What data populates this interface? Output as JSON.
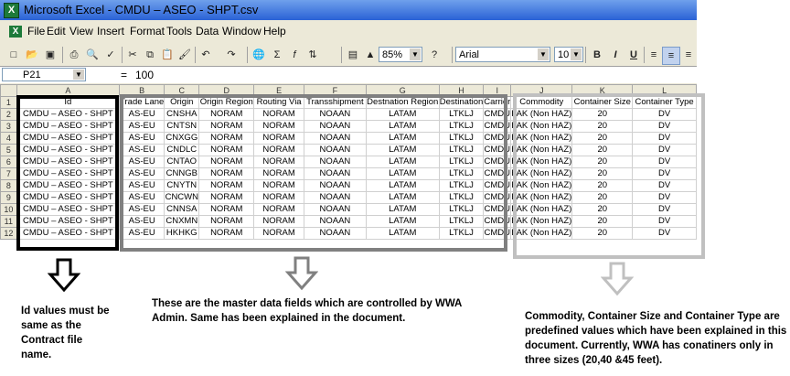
{
  "window": {
    "title": "Microsoft Excel - CMDU – ASEO - SHPT.csv",
    "app_icon": "X"
  },
  "menu": {
    "items": [
      "File",
      "Edit",
      "View",
      "Insert",
      "Format",
      "Tools",
      "Data",
      "Window",
      "Help"
    ]
  },
  "toolbar": {
    "zoom": "85%",
    "font": "Arial",
    "font_size": "10",
    "bold": "B",
    "italic": "I",
    "underline": "U",
    "icons": [
      "new-icon",
      "open-icon",
      "save-icon",
      "print-icon",
      "print-preview-icon",
      "spelling-icon",
      "cut-icon",
      "copy-icon",
      "paste-icon",
      "format-painter-icon",
      "undo-icon",
      "redo-icon",
      "hyperlink-icon",
      "autosum-icon",
      "function-icon",
      "sort-ascending-icon",
      "chart-wizard-icon",
      "drawing-icon",
      "help-icon",
      "align-left-icon",
      "align-center-icon",
      "align-right-icon"
    ]
  },
  "formula_bar": {
    "cell_ref": "P21",
    "equals": "=",
    "value": "100"
  },
  "sheet": {
    "column_letters": [
      "A",
      "B",
      "C",
      "D",
      "E",
      "F",
      "G",
      "H",
      "I",
      "J",
      "K",
      "L"
    ],
    "headers": [
      "Id",
      "Trade Lane",
      "Origin",
      "Origin Region",
      "Routing Via",
      "Transshipment",
      "Destnation Region",
      "Destination",
      "Carrier",
      "Commodity",
      "Container Size",
      "Container Type"
    ],
    "rows": [
      [
        "CMDU – ASEO - SHPT",
        "AS-EU",
        "CNSHA",
        "NORAM",
        "NORAM",
        "NOAAN",
        "LATAM",
        "LTKLJ",
        "CMDU",
        "FAK (Non HAZ)",
        "20",
        "DV"
      ],
      [
        "CMDU – ASEO - SHPT",
        "AS-EU",
        "CNTSN",
        "NORAM",
        "NORAM",
        "NOAAN",
        "LATAM",
        "LTKLJ",
        "CMDU",
        "FAK (Non HAZ)",
        "20",
        "DV"
      ],
      [
        "CMDU – ASEO - SHPT",
        "AS-EU",
        "CNXGG",
        "NORAM",
        "NORAM",
        "NOAAN",
        "LATAM",
        "LTKLJ",
        "CMDU",
        "FAK (Non HAZ)",
        "20",
        "DV"
      ],
      [
        "CMDU – ASEO - SHPT",
        "AS-EU",
        "CNDLC",
        "NORAM",
        "NORAM",
        "NOAAN",
        "LATAM",
        "LTKLJ",
        "CMDU",
        "FAK (Non HAZ)",
        "20",
        "DV"
      ],
      [
        "CMDU – ASEO - SHPT",
        "AS-EU",
        "CNTAO",
        "NORAM",
        "NORAM",
        "NOAAN",
        "LATAM",
        "LTKLJ",
        "CMDU",
        "FAK (Non HAZ)",
        "20",
        "DV"
      ],
      [
        "CMDU – ASEO - SHPT",
        "AS-EU",
        "CNNGB",
        "NORAM",
        "NORAM",
        "NOAAN",
        "LATAM",
        "LTKLJ",
        "CMDU",
        "FAK (Non HAZ)",
        "20",
        "DV"
      ],
      [
        "CMDU – ASEO - SHPT",
        "AS-EU",
        "CNYTN",
        "NORAM",
        "NORAM",
        "NOAAN",
        "LATAM",
        "LTKLJ",
        "CMDU",
        "FAK (Non HAZ)",
        "20",
        "DV"
      ],
      [
        "CMDU – ASEO - SHPT",
        "AS-EU",
        "CNCWN",
        "NORAM",
        "NORAM",
        "NOAAN",
        "LATAM",
        "LTKLJ",
        "CMDU",
        "FAK (Non HAZ)",
        "20",
        "DV"
      ],
      [
        "CMDU – ASEO - SHPT",
        "AS-EU",
        "CNNSA",
        "NORAM",
        "NORAM",
        "NOAAN",
        "LATAM",
        "LTKLJ",
        "CMDU",
        "FAK (Non HAZ)",
        "20",
        "DV"
      ],
      [
        "CMDU – ASEO - SHPT",
        "AS-EU",
        "CNXMN",
        "NORAM",
        "NORAM",
        "NOAAN",
        "LATAM",
        "LTKLJ",
        "CMDU",
        "FAK (Non HAZ)",
        "20",
        "DV"
      ],
      [
        "CMDU – ASEO - SHPT",
        "AS-EU",
        "HKHKG",
        "NORAM",
        "NORAM",
        "NOAAN",
        "LATAM",
        "LTKLJ",
        "CMDU",
        "FAK (Non HAZ)",
        "20",
        "DV"
      ]
    ]
  },
  "annotations": {
    "id_note": "Id values must be same as the Contract file name.",
    "master_note": "These are the master data fields which are controlled by WWA Admin. Same has been explained in the document.",
    "predefined_note": "Commodity, Container Size and Container Type are predefined values which have been explained in this document. Currently, WWA has conatiners only in three sizes (20,40 &45 feet).",
    "colors": {
      "id_box": "#000000",
      "master_box": "#808080",
      "predefined_box": "#c0c0c0"
    }
  }
}
